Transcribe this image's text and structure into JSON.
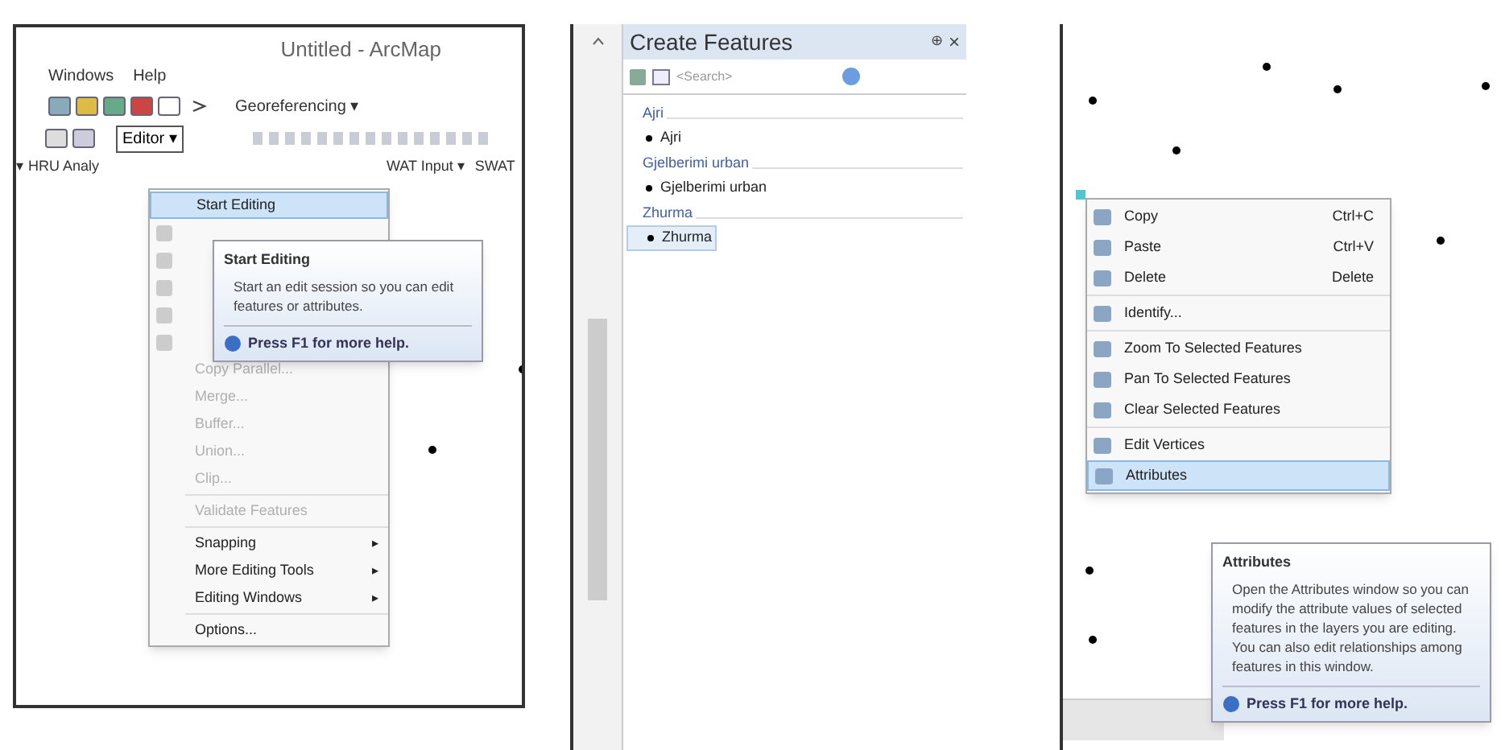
{
  "left": {
    "window": {
      "title": "Untitled - ArcMap"
    },
    "menu_bar": [
      {
        "label": "Windows"
      },
      {
        "label": "Help"
      }
    ],
    "georeferencing": "Georeferencing ▾",
    "editor_button": "Editor ▾",
    "toolbar_texts": [
      {
        "label": "▾ HRU Analy"
      },
      {
        "label": "WAT Input ▾"
      },
      {
        "label": "SWAT"
      }
    ],
    "editor_menu": [
      {
        "kind": "item",
        "label": "Start Editing",
        "selected": true,
        "disabled": false
      },
      {
        "kind": "covered"
      },
      {
        "kind": "covered"
      },
      {
        "kind": "covered"
      },
      {
        "kind": "covered"
      },
      {
        "kind": "covered"
      },
      {
        "kind": "item",
        "label": "Copy Parallel...",
        "selected": false,
        "disabled": true
      },
      {
        "kind": "item",
        "label": "Merge...",
        "selected": false,
        "disabled": true
      },
      {
        "kind": "item",
        "label": "Buffer...",
        "selected": false,
        "disabled": true
      },
      {
        "kind": "item",
        "label": "Union...",
        "selected": false,
        "disabled": true
      },
      {
        "kind": "item",
        "label": "Clip...",
        "selected": false,
        "disabled": true
      },
      {
        "kind": "separator"
      },
      {
        "kind": "item",
        "label": "Validate Features",
        "selected": false,
        "disabled": true
      },
      {
        "kind": "separator"
      },
      {
        "kind": "submenu",
        "label": "Snapping",
        "arrow": "▸",
        "selected": false,
        "disabled": false
      },
      {
        "kind": "submenu",
        "label": "More Editing Tools",
        "arrow": "▸",
        "selected": false,
        "disabled": false
      },
      {
        "kind": "submenu",
        "label": "Editing Windows",
        "arrow": "▸",
        "selected": false,
        "disabled": false
      },
      {
        "kind": "separator"
      },
      {
        "kind": "item",
        "label": "Options...",
        "selected": false,
        "disabled": false
      }
    ],
    "tooltip": {
      "title": "Start Editing",
      "body": "Start an edit session so you can edit features or attributes.",
      "help": "Press F1 for more help."
    }
  },
  "middle": {
    "panel": {
      "title": "Create Features",
      "pin": "⊕",
      "close": "×"
    },
    "search": {
      "placeholder": "<Search>"
    },
    "groups": [
      {
        "name": "Ajri",
        "templates": [
          {
            "label": "Ajri",
            "selected": false
          }
        ]
      },
      {
        "name": "Gjelberimi urban",
        "templates": [
          {
            "label": "Gjelberimi urban",
            "selected": false
          }
        ]
      },
      {
        "name": "Zhurma",
        "templates": [
          {
            "label": "Zhurma",
            "selected": true
          }
        ]
      }
    ]
  },
  "right": {
    "context_menu": [
      {
        "kind": "item",
        "label": "Copy",
        "shortcut": "Ctrl+C",
        "selected": false
      },
      {
        "kind": "item",
        "label": "Paste",
        "shortcut": "Ctrl+V",
        "selected": false
      },
      {
        "kind": "item",
        "label": "Delete",
        "shortcut": "Delete",
        "selected": false
      },
      {
        "kind": "separator"
      },
      {
        "kind": "item",
        "label": "Identify...",
        "selected": false
      },
      {
        "kind": "separator"
      },
      {
        "kind": "item",
        "label": "Zoom To Selected Features",
        "selected": false
      },
      {
        "kind": "item",
        "label": "Pan To Selected Features",
        "selected": false
      },
      {
        "kind": "item",
        "label": "Clear Selected Features",
        "selected": false
      },
      {
        "kind": "separator"
      },
      {
        "kind": "item",
        "label": "Edit Vertices",
        "selected": false
      },
      {
        "kind": "item",
        "label": "Attributes",
        "selected": true
      }
    ],
    "tooltip": {
      "title": "Attributes",
      "body": "Open the Attributes window so you can modify the attribute values of selected features in the layers you are editing. You can also edit relationships among features in this window.",
      "help": "Press F1 for more help."
    }
  }
}
